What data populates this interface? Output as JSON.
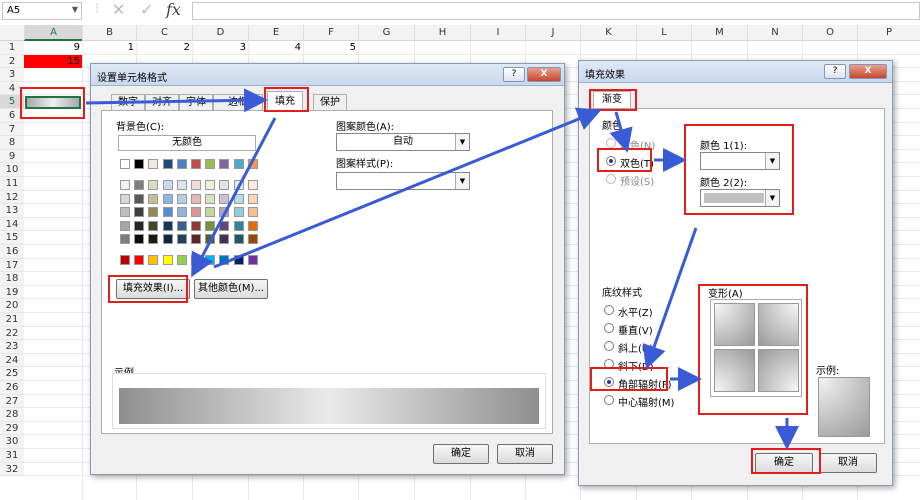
{
  "formula_bar": {
    "name_box": "A5",
    "dropdown": "▼",
    "separator": "⋮",
    "cancel": "✕",
    "enter": "✓",
    "fx": "fx"
  },
  "columns": [
    "A",
    "B",
    "C",
    "D",
    "E",
    "F",
    "G",
    "H",
    "I",
    "J",
    "K",
    "L",
    "M",
    "N",
    "O",
    "P"
  ],
  "rows": [
    "1",
    "2",
    "3",
    "4",
    "5",
    "6",
    "7",
    "8",
    "9",
    "10",
    "11",
    "12",
    "13",
    "14",
    "15",
    "16",
    "17",
    "18",
    "19",
    "20",
    "21",
    "22",
    "23",
    "24",
    "25",
    "26",
    "27",
    "28",
    "29",
    "30",
    "31",
    "32"
  ],
  "cells": {
    "a1": "9",
    "a2": "15",
    "b1": "1",
    "c1": "2",
    "d1": "3",
    "e1": "4",
    "f1": "5"
  },
  "colors": {
    "a2_fill": "#ff0000",
    "accent_red": "#e31d1d",
    "arrow_blue": "#3a5bd6"
  },
  "format_dialog": {
    "title": "设置单元格格式",
    "help": "?",
    "close": "X",
    "tabs": [
      "数字",
      "对齐",
      "字体",
      "边框",
      "填充",
      "保护"
    ],
    "background_label": "背景色(C):",
    "no_color": "无颜色",
    "pattern_color_label": "图案颜色(A):",
    "pattern_color_value": "自动",
    "pattern_style_label": "图案样式(P):",
    "fill_effects_button": "填充效果(I)...",
    "more_colors_button": "其他颜色(M)...",
    "sample_label": "示例",
    "ok": "确定",
    "cancel": "取消"
  },
  "fill_dialog": {
    "title": "填充效果",
    "help": "?",
    "close": "X",
    "tab": "渐变",
    "colors_group": "颜色",
    "radio_one": "单色(N)",
    "radio_two": "双色(T)",
    "radio_preset": "预设(S)",
    "color1_label": "颜色 1(1):",
    "color2_label": "颜色 2(2):",
    "shading_group": "底纹样式",
    "shading_options": [
      "水平(Z)",
      "垂直(V)",
      "斜上(U)",
      "斜下(D)",
      "角部辐射(F)",
      "中心辐射(M)"
    ],
    "variants_label": "变形(A)",
    "sample_label": "示例:",
    "ok": "确定",
    "cancel": "取消"
  }
}
